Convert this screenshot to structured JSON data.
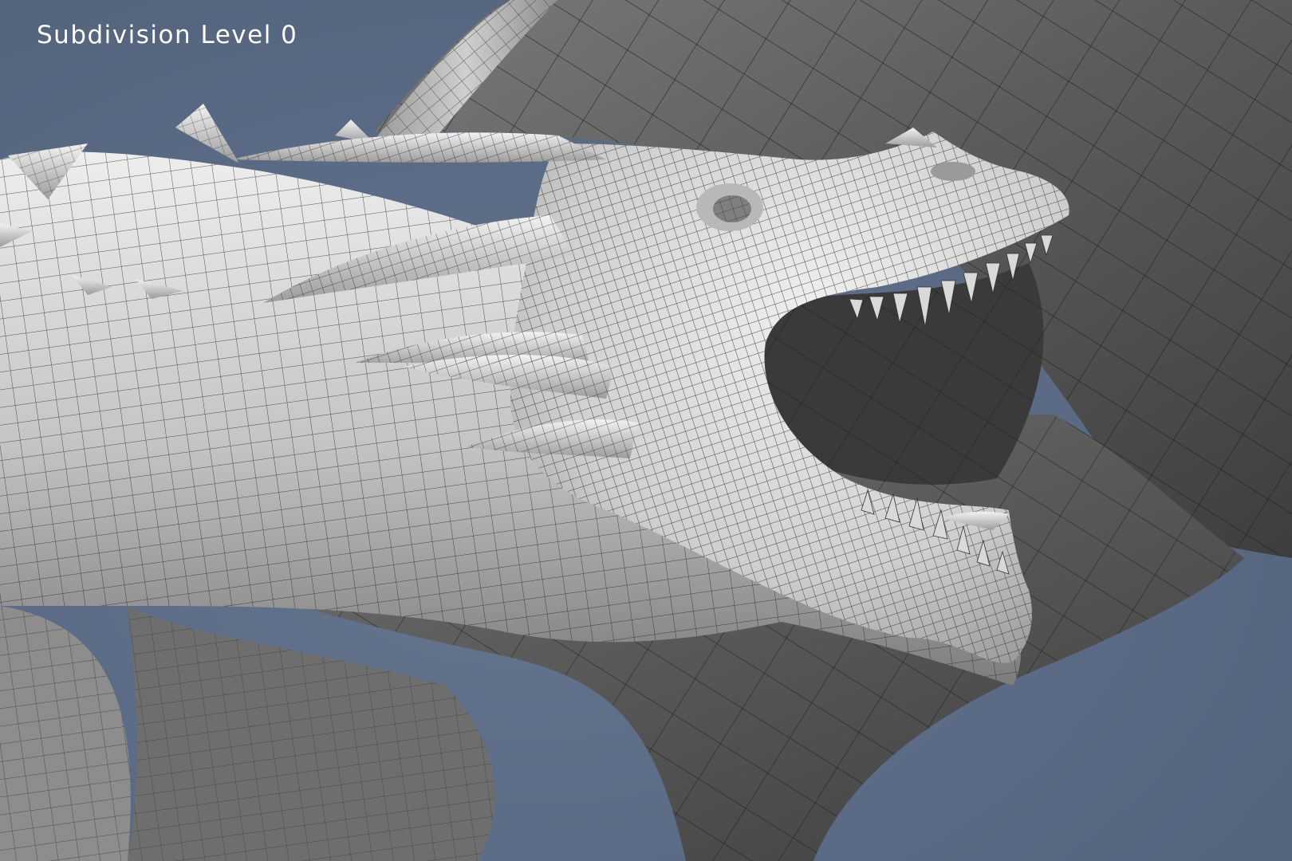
{
  "caption": "Subdivision Level 0",
  "colors": {
    "background": "#5b6b85",
    "wing_membrane": "#5a5a5a",
    "wing_bone": "#8a8a8a",
    "body_skin": "#d6d6d6",
    "wireframe": "#1e1e1e",
    "caption_text": "#ffffff"
  },
  "render": {
    "subject": "dragon",
    "shading": "grey clay with quad wireframe overlay"
  }
}
